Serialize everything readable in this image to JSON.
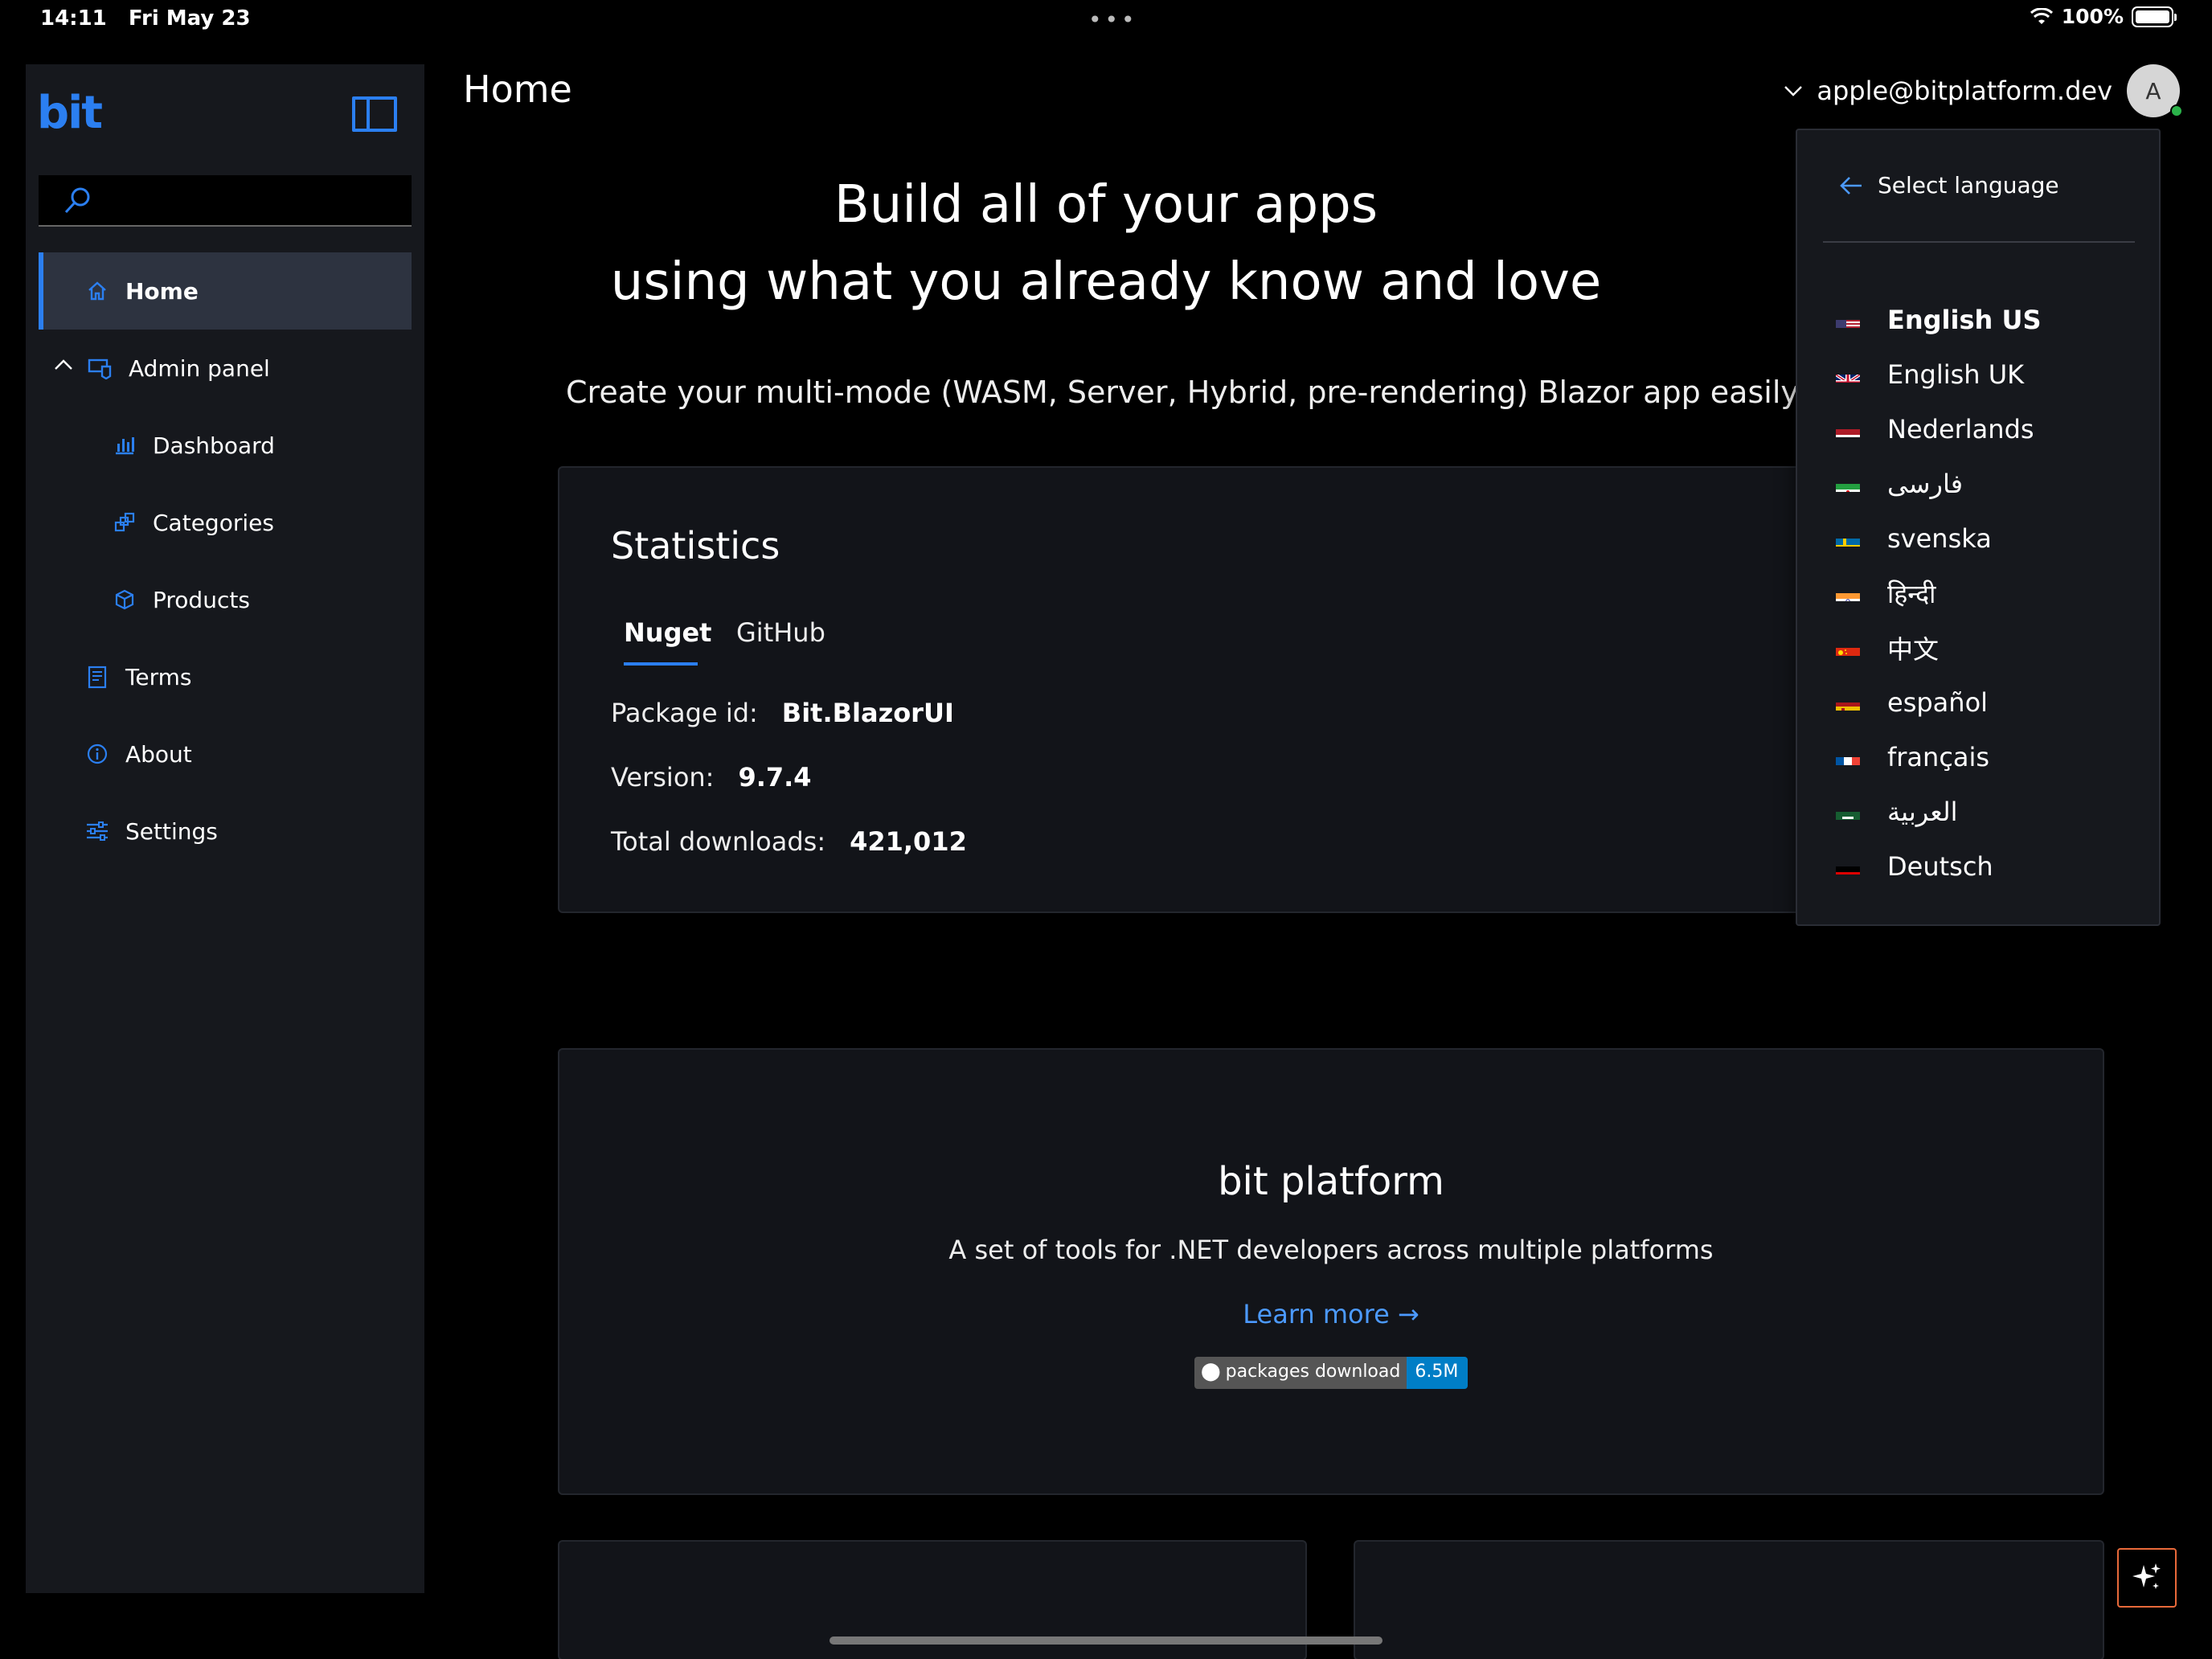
{
  "status_bar": {
    "time": "14:11",
    "date": "Fri May 23",
    "battery": "100%"
  },
  "sidebar": {
    "logo": "bit",
    "search": {
      "placeholder": "",
      "value": ""
    },
    "items": [
      {
        "label": "Home",
        "icon": "home-icon",
        "active": true
      },
      {
        "label": "Admin panel",
        "icon": "admin-panel-icon",
        "expanded": true
      },
      {
        "label": "Dashboard",
        "icon": "dashboard-icon"
      },
      {
        "label": "Categories",
        "icon": "categories-icon"
      },
      {
        "label": "Products",
        "icon": "products-icon"
      },
      {
        "label": "Terms",
        "icon": "terms-icon"
      },
      {
        "label": "About",
        "icon": "info-icon"
      },
      {
        "label": "Settings",
        "icon": "settings-icon"
      }
    ]
  },
  "header": {
    "title": "Home",
    "user_email": "apple@bitplatform.dev",
    "avatar_initial": "A"
  },
  "hero": {
    "line1": "Build all of your apps",
    "line2": "using what you already know and love",
    "description": "Create your multi-mode (WASM, Server, Hybrid, pre-rendering) Blazor app easily in th"
  },
  "statistics": {
    "title": "Statistics",
    "tabs": [
      "Nuget",
      "GitHub"
    ],
    "active_tab": "Nuget",
    "package_id_label": "Package id:",
    "package_id": "Bit.BlazorUI",
    "version_label": "Version:",
    "version": "9.7.4",
    "downloads_label": "Total downloads:",
    "downloads": "421,012"
  },
  "bit_platform": {
    "title": "bit platform",
    "description": "A set of tools for .NET developers across multiple platforms",
    "link": "Learn more",
    "badge_label": "packages download",
    "badge_value": "6.5M"
  },
  "language_menu": {
    "header": "Select language",
    "selected": "English US",
    "languages": [
      {
        "name": "English US",
        "flag": "us-flag-icon"
      },
      {
        "name": "English UK",
        "flag": "uk-flag-icon"
      },
      {
        "name": "Nederlands",
        "flag": "nl-flag-icon"
      },
      {
        "name": "فارسی",
        "flag": "ir-flag-icon"
      },
      {
        "name": "svenska",
        "flag": "se-flag-icon"
      },
      {
        "name": "हिन्दी",
        "flag": "in-flag-icon"
      },
      {
        "name": "中文",
        "flag": "cn-flag-icon"
      },
      {
        "name": "español",
        "flag": "es-flag-icon"
      },
      {
        "name": "français",
        "flag": "fr-flag-icon"
      },
      {
        "name": "العربية",
        "flag": "sa-flag-icon"
      },
      {
        "name": "Deutsch",
        "flag": "de-flag-icon"
      }
    ]
  },
  "colors": {
    "accent": "#2b7ff1",
    "link": "#4c9aff",
    "sidebar_bg": "#16181d",
    "card_bg": "#121419",
    "ai_button_border": "#e8693a"
  }
}
